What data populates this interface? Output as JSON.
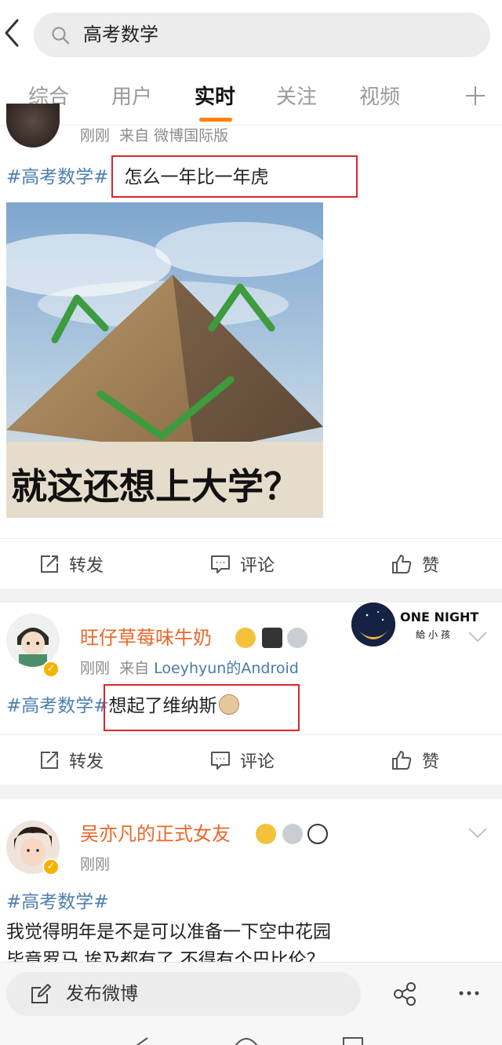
{
  "search": {
    "query": "高考数学"
  },
  "tabs": [
    {
      "label": "综合"
    },
    {
      "label": "用户"
    },
    {
      "label": "实时"
    },
    {
      "label": "关注"
    },
    {
      "label": "视频"
    }
  ],
  "active_tab": "实时",
  "colors": {
    "accent": "#ff8200",
    "username": "#e8672a",
    "hashtag": "#4d7fb1",
    "highlight_box": "#d8262d"
  },
  "post1": {
    "time": "刚刚",
    "source": "来自 微博国际版",
    "hashtag": "#高考数学#",
    "text": "怎么一年比一年虎",
    "image_caption": "就这还想上大学？"
  },
  "post2": {
    "username": "旺仔草莓味牛奶",
    "time": "刚刚",
    "source_prefix": "来自",
    "source_app": "Loeyhyun的Android",
    "hashtag": "#高考数学#",
    "text": "想起了维纳斯",
    "ad": {
      "title": "ONE NIGHT",
      "subtitle": "給小孩"
    }
  },
  "post3": {
    "username": "吴亦凡的正式女友",
    "time": "刚刚",
    "hashtag": "#高考数学#",
    "line1": "我觉得明年是不是可以准备一下空中花园",
    "line2": "毕竟罗马 埃及都有了 不得有个巴比伦？"
  },
  "actions": {
    "repost": "转发",
    "comment": "评论",
    "like": "赞"
  },
  "bottom": {
    "compose": "发布微博"
  }
}
